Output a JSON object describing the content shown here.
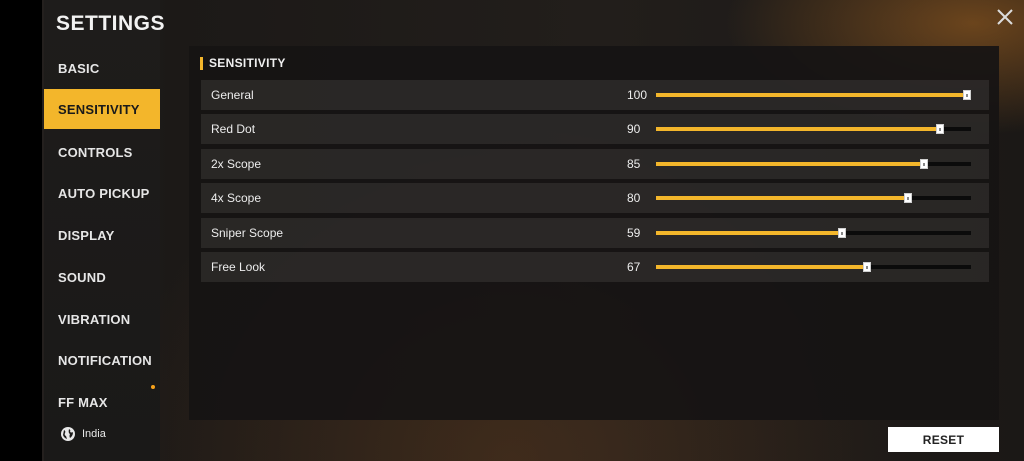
{
  "sidebar": {
    "title": "SETTINGS",
    "items": [
      {
        "label": "BASIC",
        "active": false
      },
      {
        "label": "SENSITIVITY",
        "active": true
      },
      {
        "label": "CONTROLS",
        "active": false
      },
      {
        "label": "AUTO PICKUP",
        "active": false
      },
      {
        "label": "DISPLAY",
        "active": false
      },
      {
        "label": "SOUND",
        "active": false
      },
      {
        "label": "VIBRATION",
        "active": false
      },
      {
        "label": "NOTIFICATION",
        "active": false
      },
      {
        "label": "FF MAX",
        "active": false
      }
    ],
    "region": "India",
    "region_icon": "globe-icon"
  },
  "panel": {
    "section_title": "SENSITIVITY",
    "rows": [
      {
        "label": "General",
        "value": "100",
        "fraction": 1.0
      },
      {
        "label": "Red Dot",
        "value": "90",
        "fraction": 0.9
      },
      {
        "label": "2x Scope",
        "value": "85",
        "fraction": 0.85
      },
      {
        "label": "4x Scope",
        "value": "80",
        "fraction": 0.8
      },
      {
        "label": "Sniper Scope",
        "value": "59",
        "fraction": 0.59
      },
      {
        "label": "Free Look",
        "value": "67",
        "fraction": 0.67
      }
    ]
  },
  "buttons": {
    "reset_label": "RESET",
    "close_icon": "close-icon"
  },
  "colors": {
    "accent": "#f3b62b",
    "track": "#0b0b0b"
  }
}
